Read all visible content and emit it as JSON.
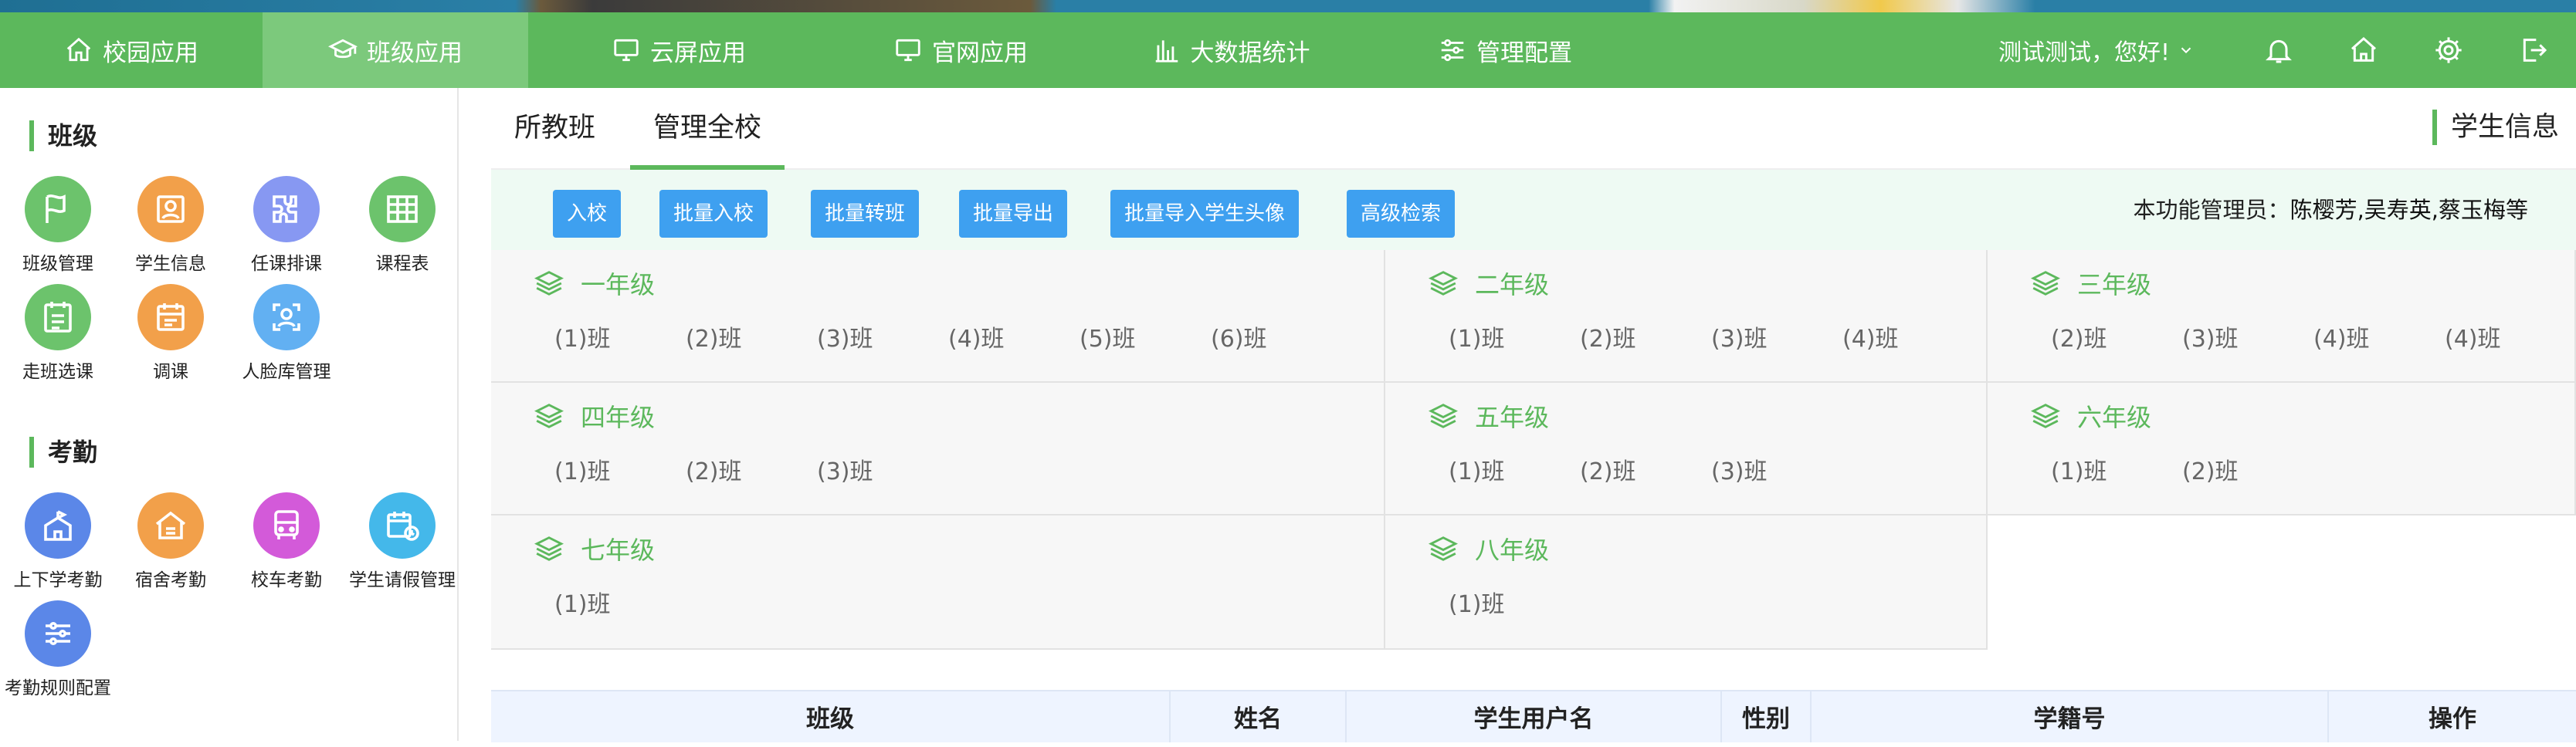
{
  "nav": {
    "items": [
      {
        "label": "校园应用",
        "icon": "home-outline-icon"
      },
      {
        "label": "班级应用",
        "icon": "graduation-cap-icon"
      },
      {
        "label": "云屏应用",
        "icon": "monitor-icon"
      },
      {
        "label": "官网应用",
        "icon": "monitor-icon"
      },
      {
        "label": "大数据统计",
        "icon": "bar-chart-icon"
      },
      {
        "label": "管理配置",
        "icon": "sliders-icon"
      }
    ],
    "greeting": "测试测试，您好!",
    "icons": [
      "bell-icon",
      "home-icon",
      "gear-icon",
      "logout-icon"
    ]
  },
  "sidebar": {
    "sections": [
      {
        "title": "班级",
        "apps": [
          {
            "label": "班级管理",
            "icon": "flag-icon",
            "color": "#5cb85c"
          },
          {
            "label": "学生信息",
            "icon": "id-card-icon",
            "color": "#f0953a"
          },
          {
            "label": "任课排课",
            "icon": "puzzle-icon",
            "color": "#7f8ff0"
          },
          {
            "label": "课程表",
            "icon": "table-icon",
            "color": "#5cb85c"
          },
          {
            "label": "走班选课",
            "icon": "checklist-icon",
            "color": "#5cb85c"
          },
          {
            "label": "调课",
            "icon": "calendar-icon",
            "color": "#f0953a"
          },
          {
            "label": "人脸库管理",
            "icon": "face-scan-icon",
            "color": "#58a8f0"
          }
        ]
      },
      {
        "title": "考勤",
        "apps": [
          {
            "label": "上下学考勤",
            "icon": "school-icon",
            "color": "#5b87e8"
          },
          {
            "label": "宿舍考勤",
            "icon": "house-icon",
            "color": "#f0953a"
          },
          {
            "label": "校车考勤",
            "icon": "bus-icon",
            "color": "#d05ad8"
          },
          {
            "label": "学生请假管理",
            "icon": "calendar-clock-icon",
            "color": "#3eb6e8"
          },
          {
            "label": "考勤规则配置",
            "icon": "sliders-icon",
            "color": "#5b87e8"
          }
        ]
      }
    ]
  },
  "tabs": [
    {
      "label": "所教班"
    },
    {
      "label": "管理全校"
    }
  ],
  "side_title": "学生信息",
  "toolbar": {
    "buttons": [
      "入校",
      "批量入校",
      "批量转班",
      "批量导出",
      "批量导入学生头像",
      "高级检索"
    ],
    "admins_label": "本功能管理员：",
    "admins_value": "陈樱芳,吴寿英,蔡玉梅等"
  },
  "grades": [
    {
      "name": "一年级",
      "classes": [
        "(1)班",
        "(2)班",
        "(3)班",
        "(4)班",
        "(5)班",
        "(6)班"
      ]
    },
    {
      "name": "二年级",
      "classes": [
        "(1)班",
        "(2)班",
        "(3)班",
        "(4)班"
      ]
    },
    {
      "name": "三年级",
      "classes": [
        "(2)班",
        "(3)班",
        "(4)班",
        "(4)班"
      ]
    },
    {
      "name": "四年级",
      "classes": [
        "(1)班",
        "(2)班",
        "(3)班"
      ]
    },
    {
      "name": "五年级",
      "classes": [
        "(1)班",
        "(2)班",
        "(3)班"
      ]
    },
    {
      "name": "六年级",
      "classes": [
        "(1)班",
        "(2)班"
      ]
    },
    {
      "name": "七年级",
      "classes": [
        "(1)班"
      ]
    },
    {
      "name": "八年级",
      "classes": [
        "(1)班"
      ]
    }
  ],
  "table": {
    "headers": [
      "班级",
      "姓名",
      "学生用户名",
      "性别",
      "学籍号",
      "操作"
    ]
  },
  "colors": {
    "accent": "#5cb85c",
    "button": "#3ea0f0",
    "toolbar_bg": "#eefaf3"
  }
}
